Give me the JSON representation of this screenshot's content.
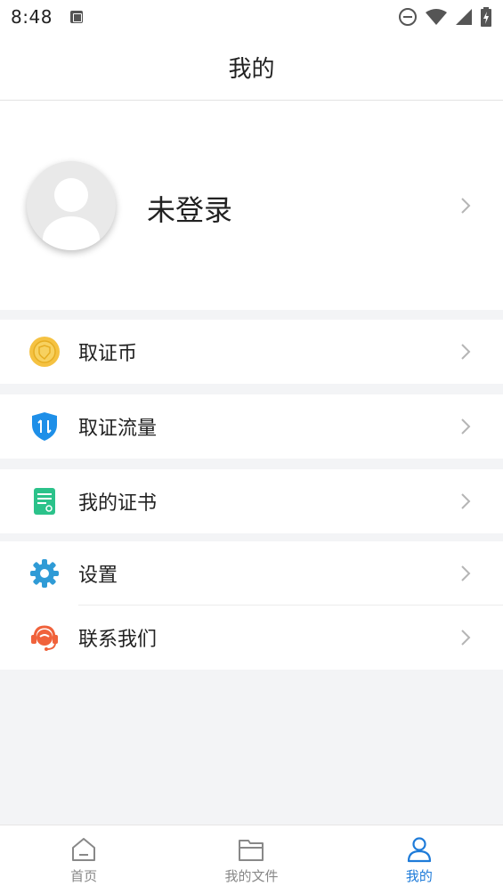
{
  "status_bar": {
    "time": "8:48",
    "icons": [
      "app-notification-icon",
      "do-not-disturb-icon",
      "wifi-icon",
      "signal-icon",
      "battery-charging-icon"
    ]
  },
  "header": {
    "title": "我的"
  },
  "profile": {
    "name": "未登录",
    "avatar_icon": "default-user-avatar"
  },
  "menu": {
    "coins": {
      "label": "取证币",
      "icon": "coin-icon",
      "color": "#f5c242"
    },
    "traffic": {
      "label": "取证流量",
      "icon": "shield-traffic-icon",
      "color": "#1e8fe8"
    },
    "certificates": {
      "label": "我的证书",
      "icon": "certificate-icon",
      "color": "#2bc28a"
    },
    "settings": {
      "label": "设置",
      "icon": "gear-icon",
      "color": "#2f9bd6"
    },
    "contact": {
      "label": "联系我们",
      "icon": "customer-service-icon",
      "color": "#f0623b"
    }
  },
  "tabs": [
    {
      "label": "首页",
      "icon": "home-icon",
      "active": false
    },
    {
      "label": "我的文件",
      "icon": "folder-icon",
      "active": false
    },
    {
      "label": "我的",
      "icon": "user-icon",
      "active": true
    }
  ],
  "colors": {
    "accent": "#1e7bd9",
    "background": "#f3f4f6"
  }
}
